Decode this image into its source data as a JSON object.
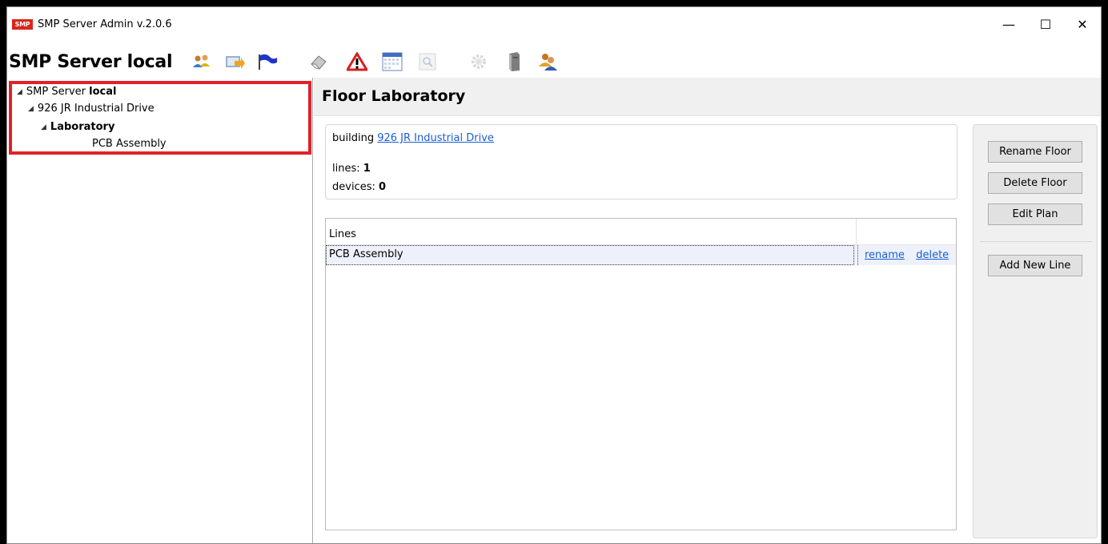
{
  "window": {
    "title": "SMP Server Admin v.2.0.6",
    "logo_text": "SMP",
    "controls": {
      "minimize": "—",
      "maximize": "☐",
      "close": "✕"
    }
  },
  "toolbar": {
    "server_title": "SMP Server local",
    "icons": [
      "users-icon",
      "import-icon",
      "flag-icon",
      "eraser-icon",
      "warning-icon",
      "calendar-icon",
      "search-icon",
      "gear-icon",
      "server-icon",
      "user-group-icon"
    ]
  },
  "tree": {
    "root_prefix": "SMP Server ",
    "root_bold": "local",
    "building": "926 JR Industrial Drive",
    "floor": "Laboratory",
    "line": "PCB Assembly",
    "arrow": "◢"
  },
  "main": {
    "title": "Floor Laboratory",
    "info": {
      "building_label": "building ",
      "building_link": "926 JR Industrial Drive",
      "lines_label": "lines: ",
      "lines_value": "1",
      "devices_label": "devices: ",
      "devices_value": "0"
    },
    "table": {
      "header": "Lines",
      "rows": [
        {
          "name": "PCB Assembly",
          "rename": "rename",
          "delete": "delete"
        }
      ]
    }
  },
  "buttons": {
    "rename_floor": "Rename Floor",
    "delete_floor": "Delete Floor",
    "edit_plan": "Edit Plan",
    "add_new_line": "Add New Line"
  },
  "colors": {
    "accent_red": "#e0222a",
    "link_blue": "#1a5fd1",
    "panel_gray": "#f0f0f0"
  }
}
